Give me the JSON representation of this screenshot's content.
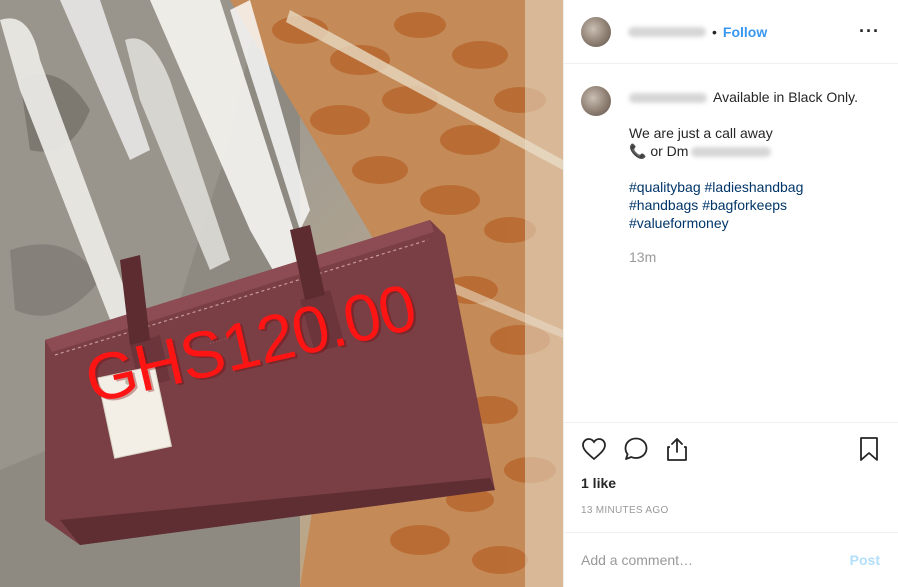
{
  "photo": {
    "price_overlay": "GHS120.00",
    "colors": {
      "bag": "#7a3f45",
      "price_text": "#ff1414",
      "wall": "#8f8c85",
      "floor_tile": "#c47a45"
    }
  },
  "header": {
    "separator": "•",
    "follow_label": "Follow",
    "more_icon": "···"
  },
  "caption": {
    "first_line": "Available in Black Only.",
    "call_line": "We are just a call away",
    "phone_icon": "📞",
    "dm_prefix": "or Dm",
    "hashtags_line1": [
      "#qualitybag",
      "#ladieshandbag"
    ],
    "hashtags_line2": [
      "#handbags",
      "#bagforkeeps"
    ],
    "hashtags_line3": [
      "#valueformoney"
    ],
    "age": "13m"
  },
  "actions": {
    "icons": [
      "heart-icon",
      "comment-icon",
      "share-icon",
      "bookmark-icon"
    ],
    "likes": "1 like",
    "time_ago": "13 MINUTES AGO"
  },
  "comment_box": {
    "placeholder": "Add a comment…",
    "post_label": "Post"
  },
  "colors": {
    "link_blue": "#3897f0",
    "hashtag": "#003569",
    "muted": "#999999",
    "post_disabled": "#b2dffc"
  }
}
